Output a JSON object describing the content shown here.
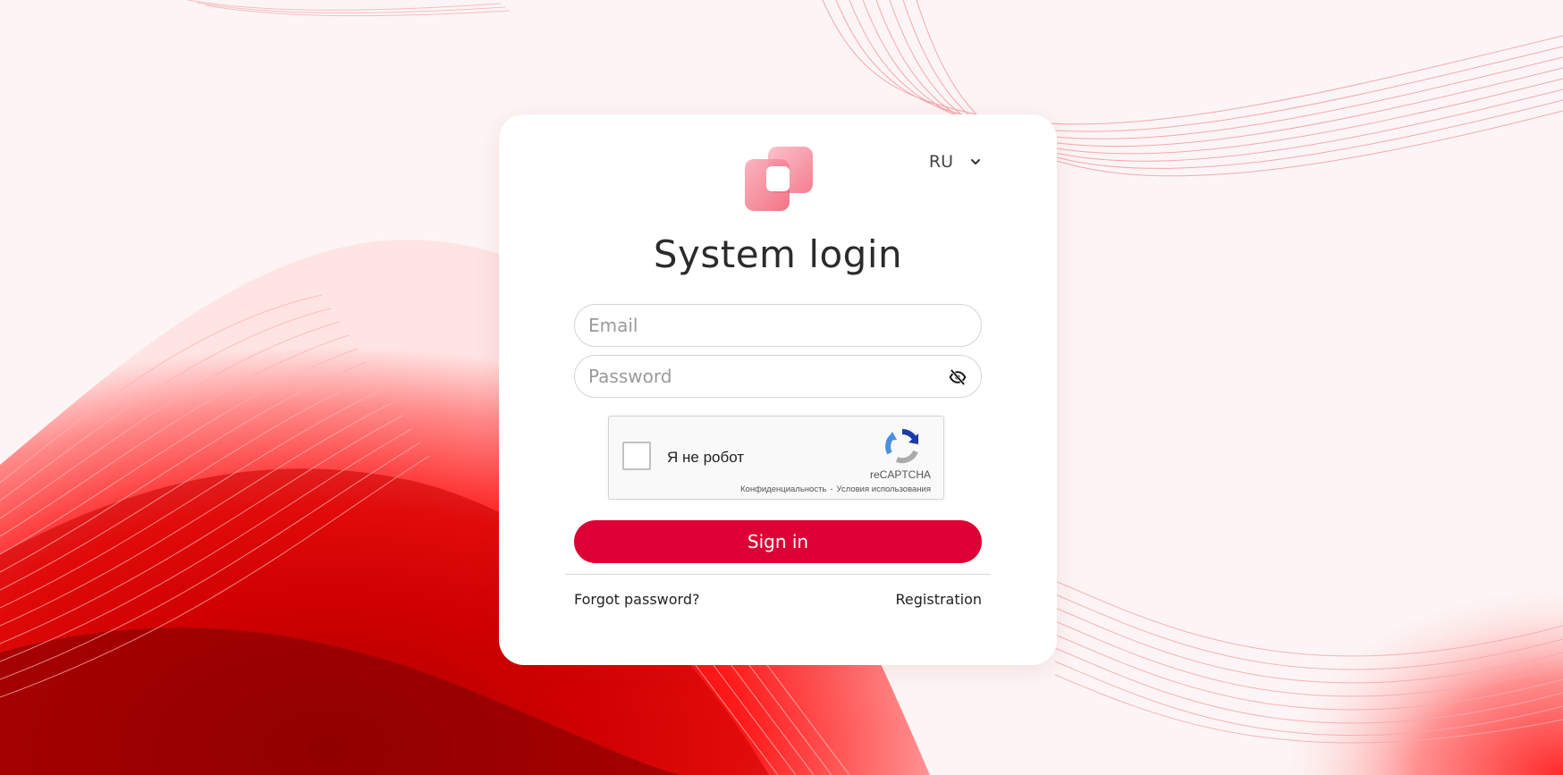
{
  "header": {
    "language": "RU"
  },
  "form": {
    "title": "System login",
    "email_placeholder": "Email",
    "password_placeholder": "Password",
    "submit_label": "Sign in"
  },
  "captcha": {
    "label": "Я не робот",
    "brand": "reCAPTCHA",
    "privacy_link": "Конфиденциальность",
    "separator": "-",
    "terms_link": "Условия использования"
  },
  "footer": {
    "forgot_password": "Forgot password?",
    "registration": "Registration"
  },
  "colors": {
    "accent": "#dc0035",
    "background_wave": "#e8001a",
    "logo_pink": "#f36f84"
  },
  "icons": {
    "language_toggle": "chevron-down-icon",
    "password_visibility": "eye-off-icon",
    "captcha_logo": "recaptcha-icon",
    "brand_logo": "stacked-squares-logo"
  }
}
